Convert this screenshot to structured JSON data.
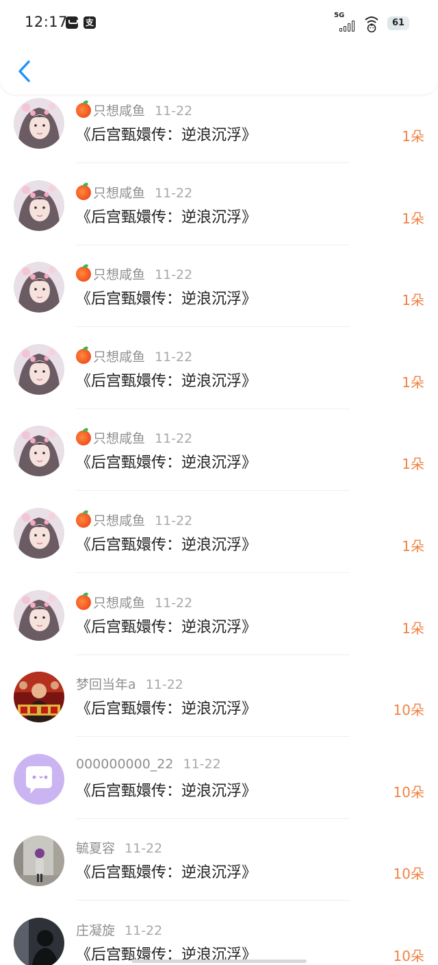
{
  "status_bar": {
    "time": "12:17",
    "network": "5G",
    "battery": "61",
    "battery_level": 0.61,
    "icons": [
      "mail-icon",
      "alipay-icon",
      "signal-icon",
      "wifi-icon",
      "battery-icon"
    ],
    "alipay_glyph": "支"
  },
  "header": {
    "back_icon": "chevron-left-icon",
    "accent_color": "#1e90ff"
  },
  "colors": {
    "count": "#f18242",
    "username": "#8f8f8f",
    "date": "#a8a8a8",
    "title": "#222222"
  },
  "gifts": [
    {
      "user": "只想咸鱼",
      "has_peach": true,
      "date": "11-22",
      "title": "《后宫甄嬛传：逆浪沉浮》",
      "count": "1朵",
      "avatar": "girl-portrait"
    },
    {
      "user": "只想咸鱼",
      "has_peach": true,
      "date": "11-22",
      "title": "《后宫甄嬛传：逆浪沉浮》",
      "count": "1朵",
      "avatar": "girl-portrait"
    },
    {
      "user": "只想咸鱼",
      "has_peach": true,
      "date": "11-22",
      "title": "《后宫甄嬛传：逆浪沉浮》",
      "count": "1朵",
      "avatar": "girl-portrait"
    },
    {
      "user": "只想咸鱼",
      "has_peach": true,
      "date": "11-22",
      "title": "《后宫甄嬛传：逆浪沉浮》",
      "count": "1朵",
      "avatar": "girl-portrait"
    },
    {
      "user": "只想咸鱼",
      "has_peach": true,
      "date": "11-22",
      "title": "《后宫甄嬛传：逆浪沉浮》",
      "count": "1朵",
      "avatar": "girl-portrait"
    },
    {
      "user": "只想咸鱼",
      "has_peach": true,
      "date": "11-22",
      "title": "《后宫甄嬛传：逆浪沉浮》",
      "count": "1朵",
      "avatar": "girl-portrait"
    },
    {
      "user": "只想咸鱼",
      "has_peach": true,
      "date": "11-22",
      "title": "《后宫甄嬛传：逆浪沉浮》",
      "count": "1朵",
      "avatar": "girl-portrait"
    },
    {
      "user": "梦回当年a",
      "has_peach": false,
      "date": "11-22",
      "title": "《后宫甄嬛传：逆浪沉浮》",
      "count": "10朵",
      "avatar": "movie-poster"
    },
    {
      "user": "000000000_22",
      "has_peach": false,
      "date": "11-22",
      "title": "《后宫甄嬛传：逆浪沉浮》",
      "count": "10朵",
      "avatar": "chat-bubble"
    },
    {
      "user": "毓夏容",
      "has_peach": false,
      "date": "11-22",
      "title": "《后宫甄嬛传：逆浪沉浮》",
      "count": "10朵",
      "avatar": "street-girl"
    },
    {
      "user": "庄凝旋",
      "has_peach": false,
      "date": "11-22",
      "title": "《后宫甄嬛传：逆浪沉浮》",
      "count": "10朵",
      "avatar": "silhouette"
    }
  ]
}
